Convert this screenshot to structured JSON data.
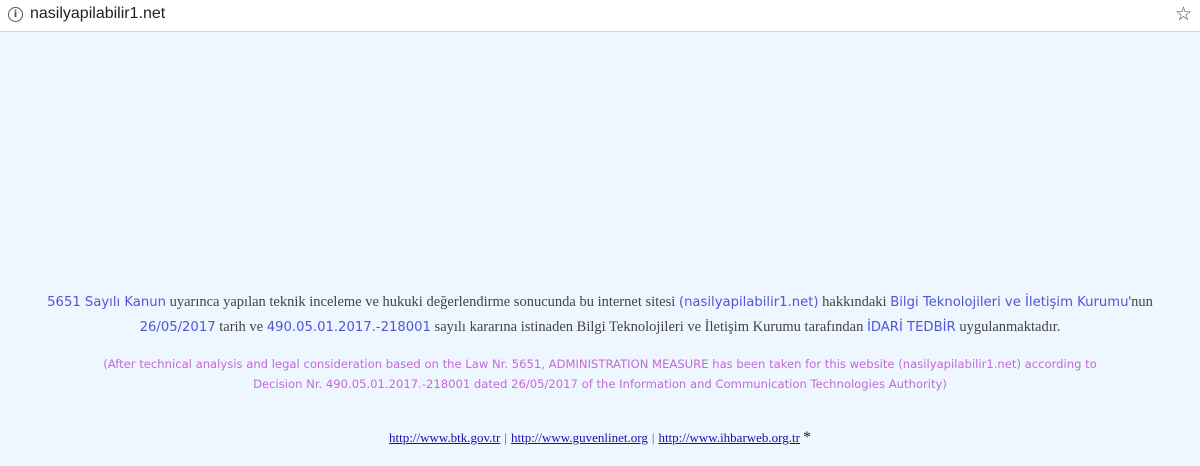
{
  "browser": {
    "url": "nasilyapilabilir1.net",
    "info_icon": "i",
    "star_icon": "☆"
  },
  "notice": {
    "law": "5651 Sayılı Kanun",
    "t1": " uyarınca yapılan teknik inceleme ve hukuki değerlendirme sonucunda bu internet sitesi ",
    "site": "(nasilyapilabilir1.net)",
    "t2": " hakkındaki ",
    "authority": "Bilgi Teknolojileri ve İletişim Kurumu",
    "t3": "'nun ",
    "date": "26/05/2017",
    "t4": " tarih ve ",
    "decision": "490.05.01.2017.-218001",
    "t5": " sayılı kararına istinaden Bilgi Teknolojileri ve İletişim Kurumu tarafından ",
    "measure": "İDARİ TEDBİR",
    "t6": " uygulanmaktadır.",
    "english": "(After technical analysis and legal consideration based on the Law Nr. 5651, ADMINISTRATION MEASURE has been taken for this website (nasilyapilabilir1.net) according to Decision Nr. 490.05.01.2017.-218001 dated 26/05/2017 of the Information and Communication Technologies Authority)"
  },
  "footer": {
    "link1": "http://www.btk.gov.tr",
    "link2": "http://www.guvenlinet.org",
    "link3": "http://www.ihbarweb.org.tr",
    "separator": "|",
    "asterisk": "*"
  },
  "colors": {
    "background": "#eef6ff",
    "highlight": "#4f56d9",
    "english_text": "#c46ad8",
    "link": "#1a0dab"
  }
}
